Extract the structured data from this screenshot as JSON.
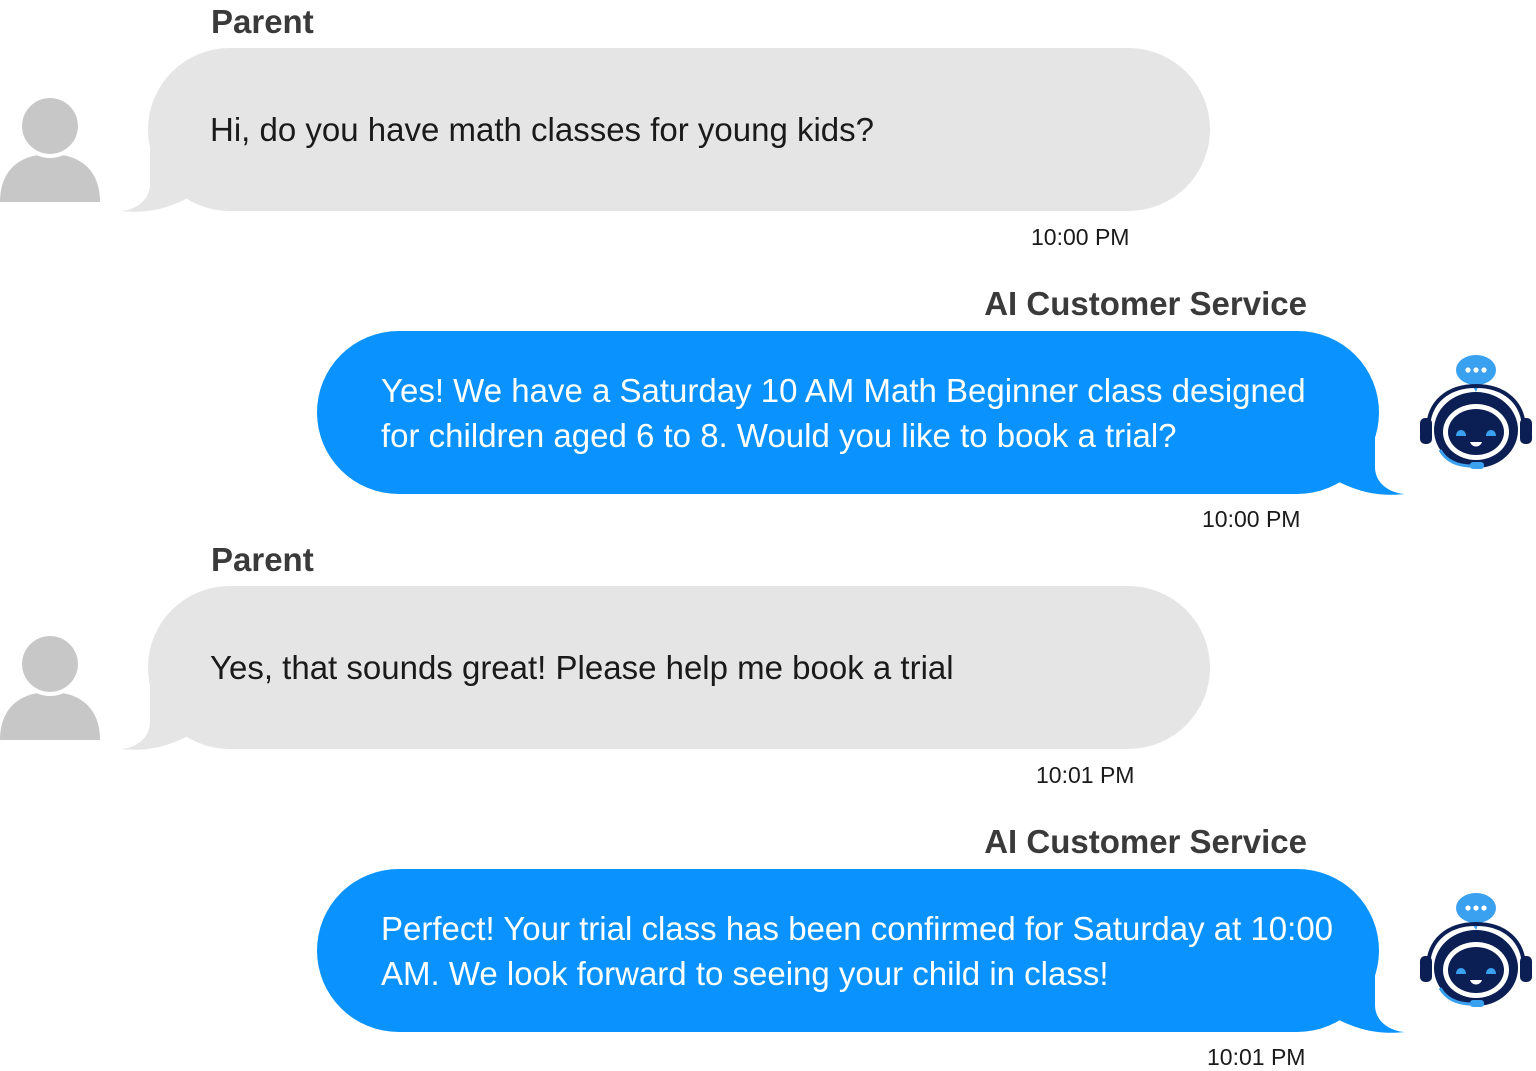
{
  "messages": [
    {
      "sender": "Parent",
      "role": "parent",
      "text": "Hi, do you have math classes for young kids?",
      "time": "10:00 PM",
      "avatar_icon": "user-silhouette-icon"
    },
    {
      "sender": "AI Customer Service",
      "role": "ai",
      "text": "Yes! We have a Saturday 10 AM Math Beginner class designed for children aged 6 to 8. Would you like to book a trial?",
      "time": "10:00 PM",
      "avatar_icon": "robot-headset-icon"
    },
    {
      "sender": "Parent",
      "role": "parent",
      "text": "Yes, that sounds great! Please help me book a trial",
      "time": "10:01 PM",
      "avatar_icon": "user-silhouette-icon"
    },
    {
      "sender": "AI Customer Service",
      "role": "ai",
      "text": "Perfect! Your trial class has been confirmed for Saturday at 10:00 AM.  We look forward to seeing your child in class!",
      "time": "10:01 PM",
      "avatar_icon": "robot-headset-icon"
    }
  ],
  "colors": {
    "parent_bubble": "#e5e5e5",
    "ai_bubble": "#0a93ff",
    "avatar_gray": "#c7c7c7",
    "robot_navy": "#0c1f55",
    "robot_blue": "#3aa0f0"
  }
}
